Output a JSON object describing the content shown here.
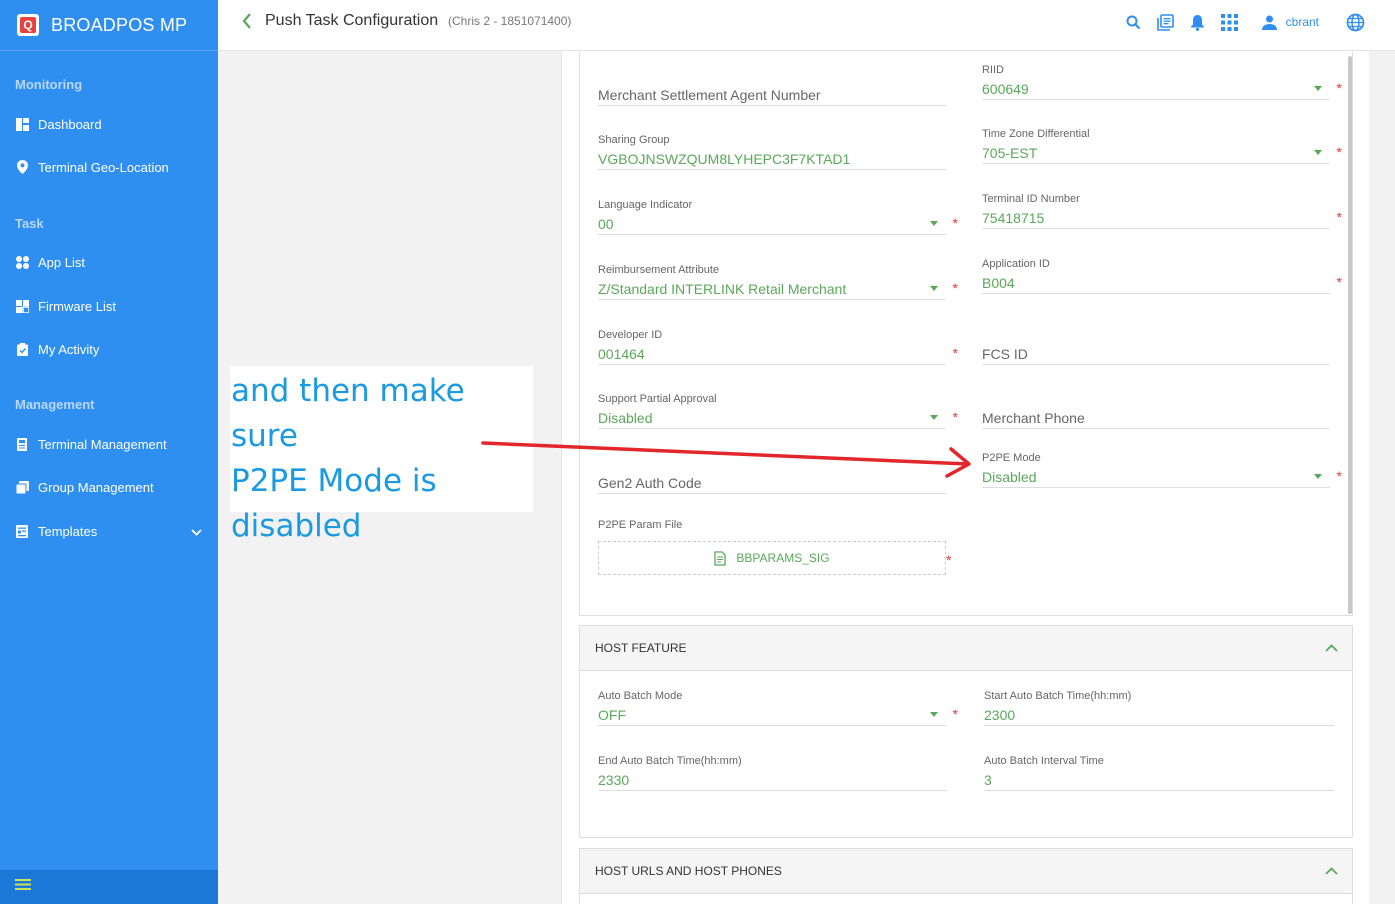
{
  "brand": {
    "title": "BROADPOS MP"
  },
  "sidebar": {
    "sections": [
      "Monitoring",
      "Task",
      "Management"
    ],
    "items": [
      {
        "label": "Dashboard",
        "icon": "dashboard-icon"
      },
      {
        "label": "Terminal Geo-Location",
        "icon": "location-pin-icon"
      },
      {
        "label": "App List",
        "icon": "apps-icon"
      },
      {
        "label": "Firmware List",
        "icon": "firmware-icon"
      },
      {
        "label": "My Activity",
        "icon": "clipboard-icon"
      },
      {
        "label": "Terminal Management",
        "icon": "terminal-icon"
      },
      {
        "label": "Group Management",
        "icon": "group-icon"
      },
      {
        "label": "Templates",
        "icon": "template-icon"
      }
    ]
  },
  "header": {
    "title": "Push Task Configuration",
    "subtitle": "(Chris 2 - 1851071400)",
    "user": "cbrant"
  },
  "form": {
    "merchant_settlement_agent_number": {
      "label": "Merchant Settlement Agent Number",
      "value": ""
    },
    "riid": {
      "label": "RIID",
      "value": "600649"
    },
    "sharing_group": {
      "label": "Sharing Group",
      "value": "VGBOJNSWZQUM8LYHEPC3F7KTAD1"
    },
    "time_zone_differential": {
      "label": "Time Zone Differential",
      "value": "705-EST"
    },
    "language_indicator": {
      "label": "Language Indicator",
      "value": "00"
    },
    "terminal_id_number": {
      "label": "Terminal ID Number",
      "value": "75418715"
    },
    "reimbursement_attribute": {
      "label": "Reimbursement Attribute",
      "value": "Z/Standard INTERLINK Retail Merchant"
    },
    "application_id": {
      "label": "Application ID",
      "value": "B004"
    },
    "developer_id": {
      "label": "Developer ID",
      "value": "001464"
    },
    "fcs_id": {
      "label": "FCS ID",
      "value": ""
    },
    "support_partial_approval": {
      "label": "Support Partial Approval",
      "value": "Disabled"
    },
    "merchant_phone": {
      "label": "Merchant Phone",
      "value": ""
    },
    "gen2_auth_code": {
      "label": "Gen2 Auth Code",
      "value": ""
    },
    "p2pe_mode": {
      "label": "P2PE Mode",
      "value": "Disabled"
    },
    "p2pe_param_file": {
      "label": "P2PE Param File",
      "value": "BBPARAMS_SIG"
    }
  },
  "host_feature": {
    "title": "HOST FEATURE",
    "auto_batch_mode": {
      "label": "Auto Batch Mode",
      "value": "OFF"
    },
    "start_auto_batch_time": {
      "label": "Start Auto Batch Time(hh:mm)",
      "value": "2300"
    },
    "end_auto_batch_time": {
      "label": "End Auto Batch Time(hh:mm)",
      "value": "2330"
    },
    "auto_batch_interval_time": {
      "label": "Auto Batch Interval Time",
      "value": "3"
    }
  },
  "host_urls": {
    "title": "HOST URLS AND HOST PHONES"
  },
  "annotation": {
    "lines": [
      "and then make sure",
      "P2PE Mode is",
      "disabled"
    ]
  },
  "colors": {
    "sidebar": "#2f8ff0",
    "value_green": "#5aa85a",
    "required_red": "#e53935",
    "annotation_blue": "#1a9ae0",
    "arrow_red": "#e3262b"
  }
}
